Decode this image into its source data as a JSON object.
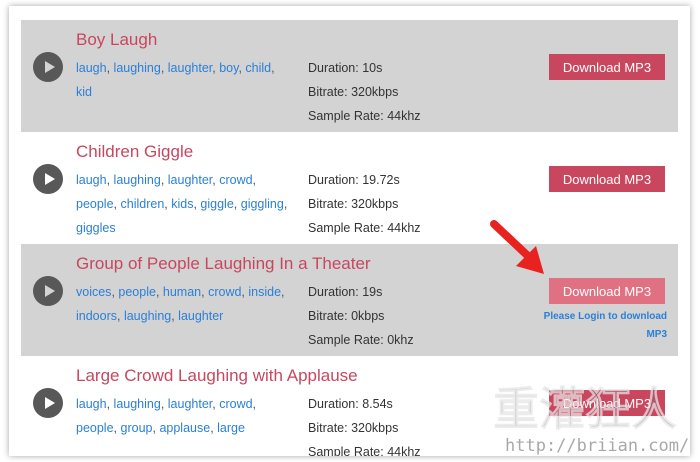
{
  "sounds": [
    {
      "title": "Boy Laugh",
      "tags": [
        "laugh",
        "laughing",
        "laughter",
        "boy",
        "child",
        "kid"
      ],
      "duration": "Duration: 10s",
      "bitrate": "Bitrate: 320kbps",
      "sample_rate": "Sample Rate: 44khz",
      "download_label": "Download MP3"
    },
    {
      "title": "Children Giggle",
      "tags": [
        "laugh",
        "laughing",
        "laughter",
        "crowd",
        "people",
        "children",
        "kids",
        "giggle",
        "giggling",
        "giggles"
      ],
      "duration": "Duration: 19.72s",
      "bitrate": "Bitrate: 320kbps",
      "sample_rate": "Sample Rate: 44khz",
      "download_label": "Download MP3"
    },
    {
      "title": "Group of People Laughing In a Theater",
      "tags": [
        "voices",
        "people",
        "human",
        "crowd",
        "inside",
        "indoors",
        "laughing",
        "laughter"
      ],
      "duration": "Duration: 19s",
      "bitrate": "Bitrate: 0kbps",
      "sample_rate": "Sample Rate: 0khz",
      "download_label": "Download MP3",
      "login_note": "Please Login to download MP3"
    },
    {
      "title": "Large Crowd Laughing with Applause",
      "tags": [
        "laugh",
        "laughing",
        "laughter",
        "crowd",
        "people",
        "group",
        "applause",
        "large"
      ],
      "duration": "Duration: 8.54s",
      "bitrate": "Bitrate: 320kbps",
      "sample_rate": "Sample Rate: 44khz",
      "download_label": "Download MP3"
    }
  ],
  "colors": {
    "title": "#c8475f",
    "button": "#c8475f",
    "button_disabled": "#e07183",
    "tag_link": "#2b7fd6",
    "row_shaded": "#d3d3d3",
    "arrow": "#e8231f"
  },
  "watermark": {
    "brand": "重灌狂人",
    "url": "http://briian.com/"
  }
}
